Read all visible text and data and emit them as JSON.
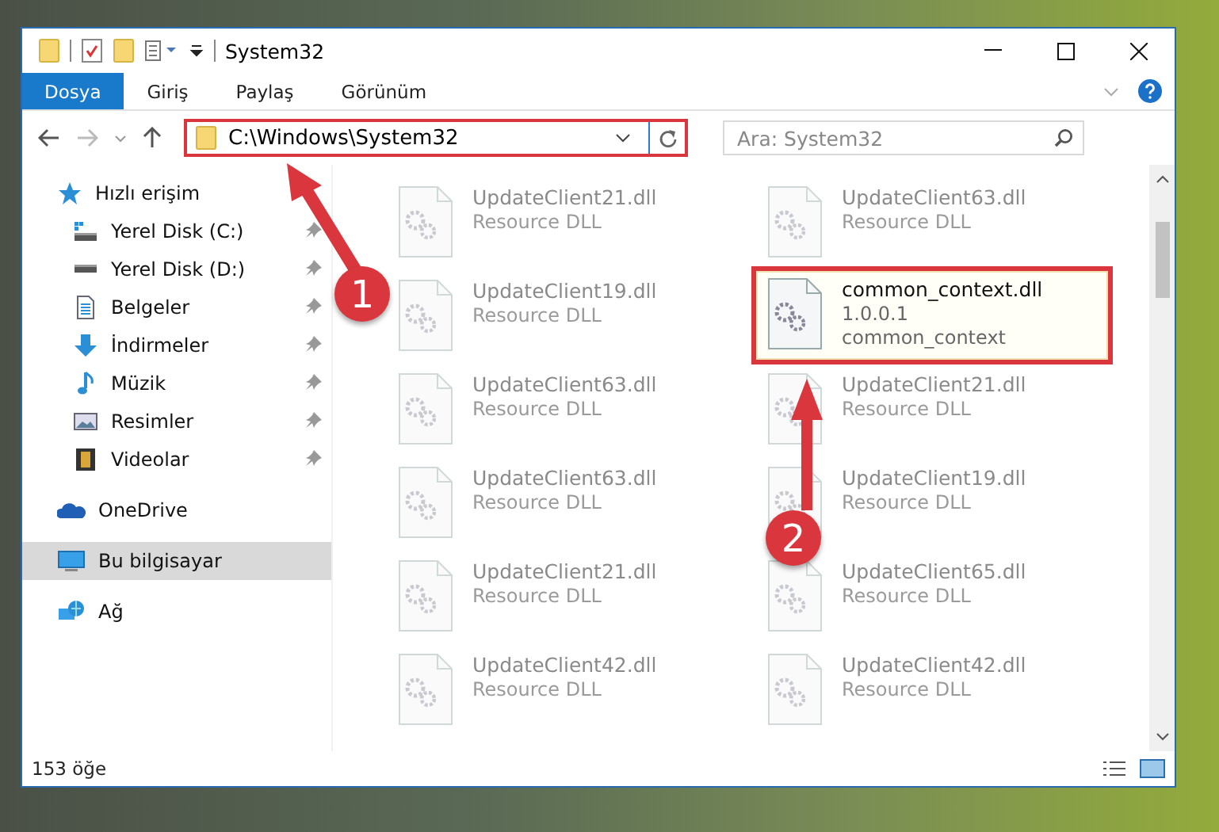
{
  "window": {
    "title": "System32"
  },
  "ribbon_tabs": [
    {
      "label": "Dosya",
      "selected": true
    },
    {
      "label": "Giriş",
      "selected": false
    },
    {
      "label": "Paylaş",
      "selected": false
    },
    {
      "label": "Görünüm",
      "selected": false
    }
  ],
  "address_bar": {
    "path": "C:\\Windows\\System32"
  },
  "search": {
    "placeholder": "Ara: System32"
  },
  "sidebar": {
    "items": [
      {
        "label": "Hızlı erişim",
        "kind": "star",
        "selected": false,
        "pinned": false,
        "children": [
          {
            "label": "Yerel Disk (C:)",
            "kind": "drive-c",
            "selected": false,
            "pinned": true
          },
          {
            "label": "Yerel Disk (D:)",
            "kind": "drive",
            "selected": false,
            "pinned": true
          },
          {
            "label": "Belgeler",
            "kind": "document",
            "selected": false,
            "pinned": true
          },
          {
            "label": "İndirmeler",
            "kind": "download",
            "selected": false,
            "pinned": true
          },
          {
            "label": "Müzik",
            "kind": "music",
            "selected": false,
            "pinned": true
          },
          {
            "label": "Resimler",
            "kind": "picture",
            "selected": false,
            "pinned": true
          },
          {
            "label": "Videolar",
            "kind": "video",
            "selected": false,
            "pinned": true
          }
        ]
      },
      {
        "label": "OneDrive",
        "kind": "cloud",
        "selected": false,
        "pinned": false
      },
      {
        "label": "Bu bilgisayar",
        "kind": "computer",
        "selected": true,
        "pinned": false
      },
      {
        "label": "Ağ",
        "kind": "network",
        "selected": false,
        "pinned": false
      }
    ]
  },
  "files": [
    {
      "name": "UpdateClient21.dll",
      "details": [
        "Resource DLL"
      ],
      "faded": true
    },
    {
      "name": "UpdateClient63.dll",
      "details": [
        "Resource DLL"
      ],
      "faded": true
    },
    {
      "name": "UpdateClient19.dll",
      "details": [
        "Resource DLL"
      ],
      "faded": true
    },
    {
      "name": "common_context.dll",
      "details": [
        "1.0.0.1",
        "common_context"
      ],
      "faded": false
    },
    {
      "name": "UpdateClient63.dll",
      "details": [
        "Resource DLL"
      ],
      "faded": true
    },
    {
      "name": "UpdateClient21.dll",
      "details": [
        "Resource DLL"
      ],
      "faded": true
    },
    {
      "name": "UpdateClient63.dll",
      "details": [
        "Resource DLL"
      ],
      "faded": true
    },
    {
      "name": "UpdateClient19.dll",
      "details": [
        "Resource DLL"
      ],
      "faded": true
    },
    {
      "name": "UpdateClient21.dll",
      "details": [
        "Resource DLL"
      ],
      "faded": true
    },
    {
      "name": "UpdateClient65.dll",
      "details": [
        "Resource DLL"
      ],
      "faded": true
    },
    {
      "name": "UpdateClient42.dll",
      "details": [
        "Resource DLL"
      ],
      "faded": true
    },
    {
      "name": "UpdateClient42.dll",
      "details": [
        "Resource DLL"
      ],
      "faded": true
    }
  ],
  "status_bar": {
    "count": "153 öğe"
  },
  "annotations": [
    {
      "label": "1"
    },
    {
      "label": "2"
    }
  ]
}
